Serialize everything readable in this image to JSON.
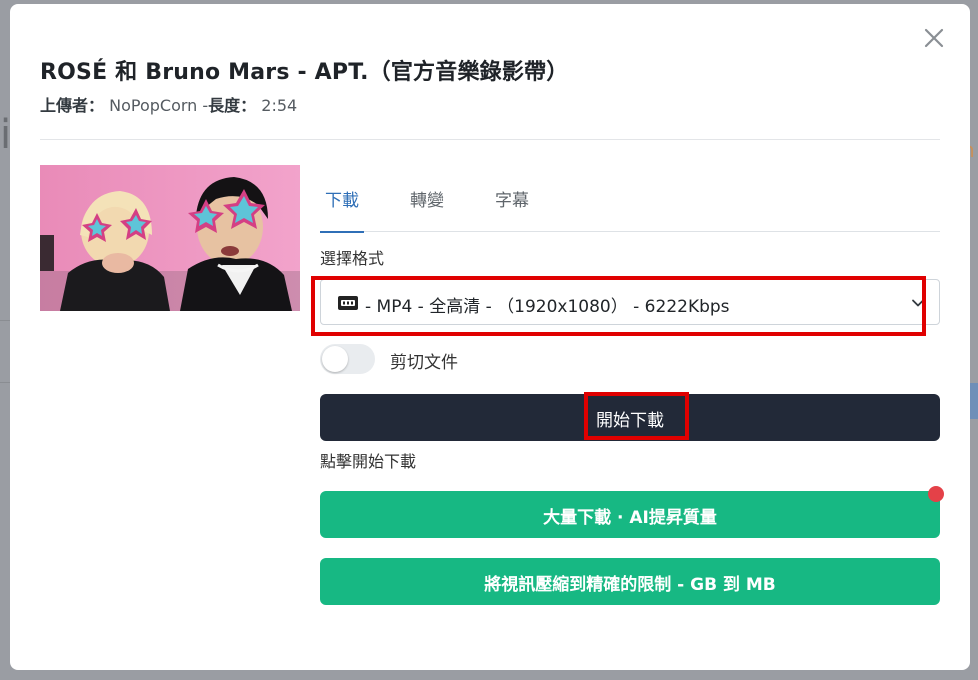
{
  "colors": {
    "overlay": "#9a9da3",
    "tab_active": "#2f6fb7",
    "primary_dark": "#222938",
    "action_green": "#17b883",
    "highlight_red": "#e00000",
    "notification_dot": "#e44148"
  },
  "modal": {
    "title": "ROSÉ 和 Bruno Mars - APT.（官方音樂錄影帶）",
    "uploader_label": "上傳者：",
    "uploader": "NoPopCorn",
    "separator": " -",
    "duration_label": "長度：",
    "duration": "2:54",
    "close_icon": "close-icon"
  },
  "tabs": [
    {
      "label": "下載",
      "active": true
    },
    {
      "label": "轉變",
      "active": false
    },
    {
      "label": "字幕",
      "active": false
    }
  ],
  "format": {
    "label": "選擇格式",
    "icon": "video-file-icon",
    "selected": " - MP4 - 全高清 - （1920x1080） - 6222Kbps"
  },
  "trim": {
    "label": "剪切文件",
    "on": false
  },
  "download": {
    "button_label": "開始下載",
    "hint": "點擊開始下載"
  },
  "actions": {
    "bulk_label": "大量下載 · AI提昇質量",
    "compress_label": "將視訊壓縮到精確的限制 - GB 到 MB"
  }
}
